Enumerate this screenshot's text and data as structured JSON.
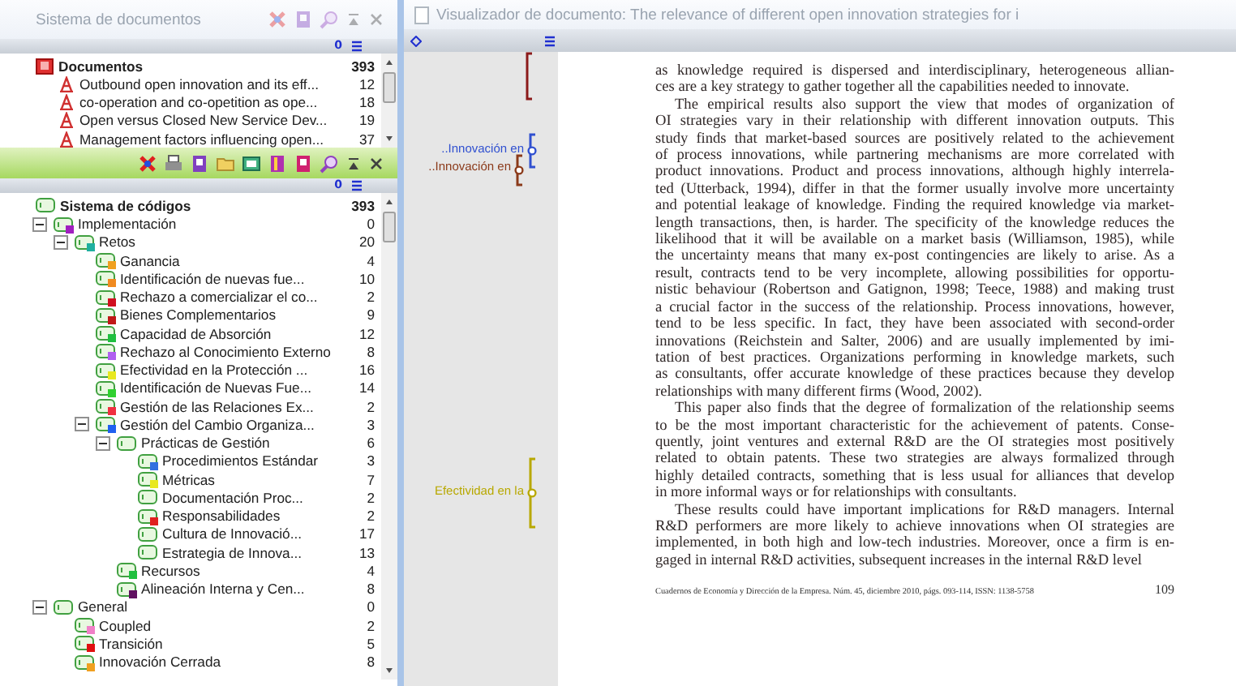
{
  "document_system": {
    "title": "Sistema de documentos",
    "counter": "0",
    "root": {
      "label": "Documentos",
      "count": "393"
    },
    "documents": [
      {
        "label": "Outbound open innovation and its eff...",
        "count": "12"
      },
      {
        "label": "co-operation and co-opetition as ope...",
        "count": "18"
      },
      {
        "label": "Open versus Closed New Service Dev...",
        "count": "19"
      },
      {
        "label": "Management factors influencing open...",
        "count": "37"
      }
    ]
  },
  "code_system": {
    "counter": "0",
    "root": {
      "label": "Sistema de códigos",
      "count": "393"
    },
    "children": [
      {
        "label": "Implementación",
        "count": "0",
        "color": "#a020c0",
        "expanded": true,
        "children": [
          {
            "label": "Retos",
            "count": "20",
            "color": "#20b0a0",
            "expanded": true,
            "children": [
              {
                "label": "Ganancia",
                "count": "4",
                "color": "#f0a020"
              },
              {
                "label": "Identificación de nuevas fue...",
                "count": "10",
                "color": "#f08a20"
              },
              {
                "label": "Rechazo a comercializar el co...",
                "count": "2",
                "color": "#d01020"
              },
              {
                "label": "Bienes Complementarios",
                "count": "9",
                "color": "#c01818"
              },
              {
                "label": "Capacidad de Absorción",
                "count": "12",
                "color": "#20c040"
              },
              {
                "label": "Rechazo al Conocimiento Externo",
                "count": "8",
                "color": "#b060f0"
              },
              {
                "label": "Efectividad en la Protección ...",
                "count": "16",
                "color": "#e8e820"
              },
              {
                "label": "Identificación de Nuevas Fue...",
                "count": "14",
                "color": "#30d030"
              },
              {
                "label": "Gestión de las Relaciones Ex...",
                "count": "2",
                "color": "#f03040"
              },
              {
                "label": "Gestión del Cambio Organiza...",
                "count": "3",
                "color": "#2060f0",
                "expanded": true,
                "children": [
                  {
                    "label": "Prácticas de Gestión",
                    "count": "6",
                    "expanded": true,
                    "children": [
                      {
                        "label": "Procedimientos Estándar",
                        "count": "3",
                        "color": "#3070e0"
                      },
                      {
                        "label": "Métricas",
                        "count": "7",
                        "color": "#e8e820"
                      },
                      {
                        "label": "Documentación Proc...",
                        "count": "2"
                      },
                      {
                        "label": "Responsabilidades",
                        "count": "2",
                        "color": "#e02020"
                      },
                      {
                        "label": "Cultura de Innovació...",
                        "count": "17"
                      },
                      {
                        "label": "Estrategia de Innova...",
                        "count": "13"
                      }
                    ]
                  },
                  {
                    "label": "Recursos",
                    "count": "4",
                    "color": "#20c040"
                  },
                  {
                    "label": "Alineación Interna y Cen...",
                    "count": "8",
                    "color": "#601060"
                  }
                ]
              }
            ]
          }
        ]
      },
      {
        "label": "General",
        "count": "0",
        "expanded": true,
        "children": [
          {
            "label": "Coupled",
            "count": "2",
            "color": "#f080c8"
          },
          {
            "label": "Transición",
            "count": "5",
            "color": "#e01010"
          },
          {
            "label": "Innovación Cerrada",
            "count": "8",
            "color": "#f0a020"
          }
        ]
      }
    ]
  },
  "viewer": {
    "title": "Visualizador de documento: The relevance of different open innovation strategies for i",
    "margin_markers": [
      {
        "color": "#8b1a1a"
      },
      {
        "label": "..Innovación en",
        "color": "#3050d0"
      },
      {
        "label": "..Innovación en",
        "color": "#8b3a1a"
      },
      {
        "label": "Efectividad en la",
        "color": "#b8a800"
      }
    ],
    "paragraphs": [
      {
        "indented": false,
        "lines": [
          "as knowledge required is dispersed and interdisciplinary, heterogeneous allian-",
          "ces are a key strategy to gather together all the capabilities needed to innovate."
        ]
      },
      {
        "indented": true,
        "lines": [
          "The empirical results also support the view that modes of organization of",
          "OI strategies vary in their relationship with different innovation outputs. This",
          "study finds that market-based sources are positively related to the achievement",
          "of process innovations, while partnering mechanisms are more correlated with",
          "product innovations. Product and process innovations, although highly interrela-",
          "ted (Utterback, 1994), differ in that the former usually involve more uncertainty",
          "and potential leakage of knowledge. Finding the required knowledge via market-",
          "length transactions, then, is harder. The specificity of the knowledge reduces the",
          "likelihood that it will be available on a market basis (Williamson, 1985), while",
          "the uncertainty means that many ex-post contingencies are likely to arise. As a",
          "result, contracts tend to be very incomplete, allowing possibilities for opportu-",
          "nistic behaviour (Robertson and Gatignon, 1998; Teece, 1988) and making trust",
          "a crucial factor in the success of the relationship. Process innovations, however,",
          "tend to be less specific. In fact, they have been associated with second-order",
          "innovations (Reichstein and Salter, 2006) and are usually implemented by imi-",
          "tation of best practices. Organizations performing in knowledge markets, such",
          "as consultants, offer accurate knowledge of these practices because they develop",
          "relationships with many different firms (Wood, 2002)."
        ]
      },
      {
        "indented": true,
        "lines": [
          "This paper also finds that the degree of formalization of the relationship seems",
          "to be the most important characteristic for the achievement of patents. Conse-",
          "quently, joint ventures and external R&D are the OI strategies most positively",
          "related to obtain patents. These two strategies are always formalized through",
          "highly detailed contracts, something that is less usual for alliances that develop",
          "in more informal ways or for relationships with consultants."
        ]
      },
      {
        "indented": true,
        "lines": [
          "These results could have important implications for R&D managers. Internal",
          "R&D performers are more likely to achieve innovations when OI strategies are",
          "implemented, in both high and low-tech industries. Moreover, once a firm is en-",
          "gaged in internal R&D activities, subsequent increases in the internal R&D level"
        ]
      }
    ],
    "footer": {
      "citation": "Cuadernos de Economía y Dirección de la Empresa. Núm. 45, diciembre 2010, págs. 093-114, ISSN: 1138-5758",
      "page": "109"
    }
  }
}
